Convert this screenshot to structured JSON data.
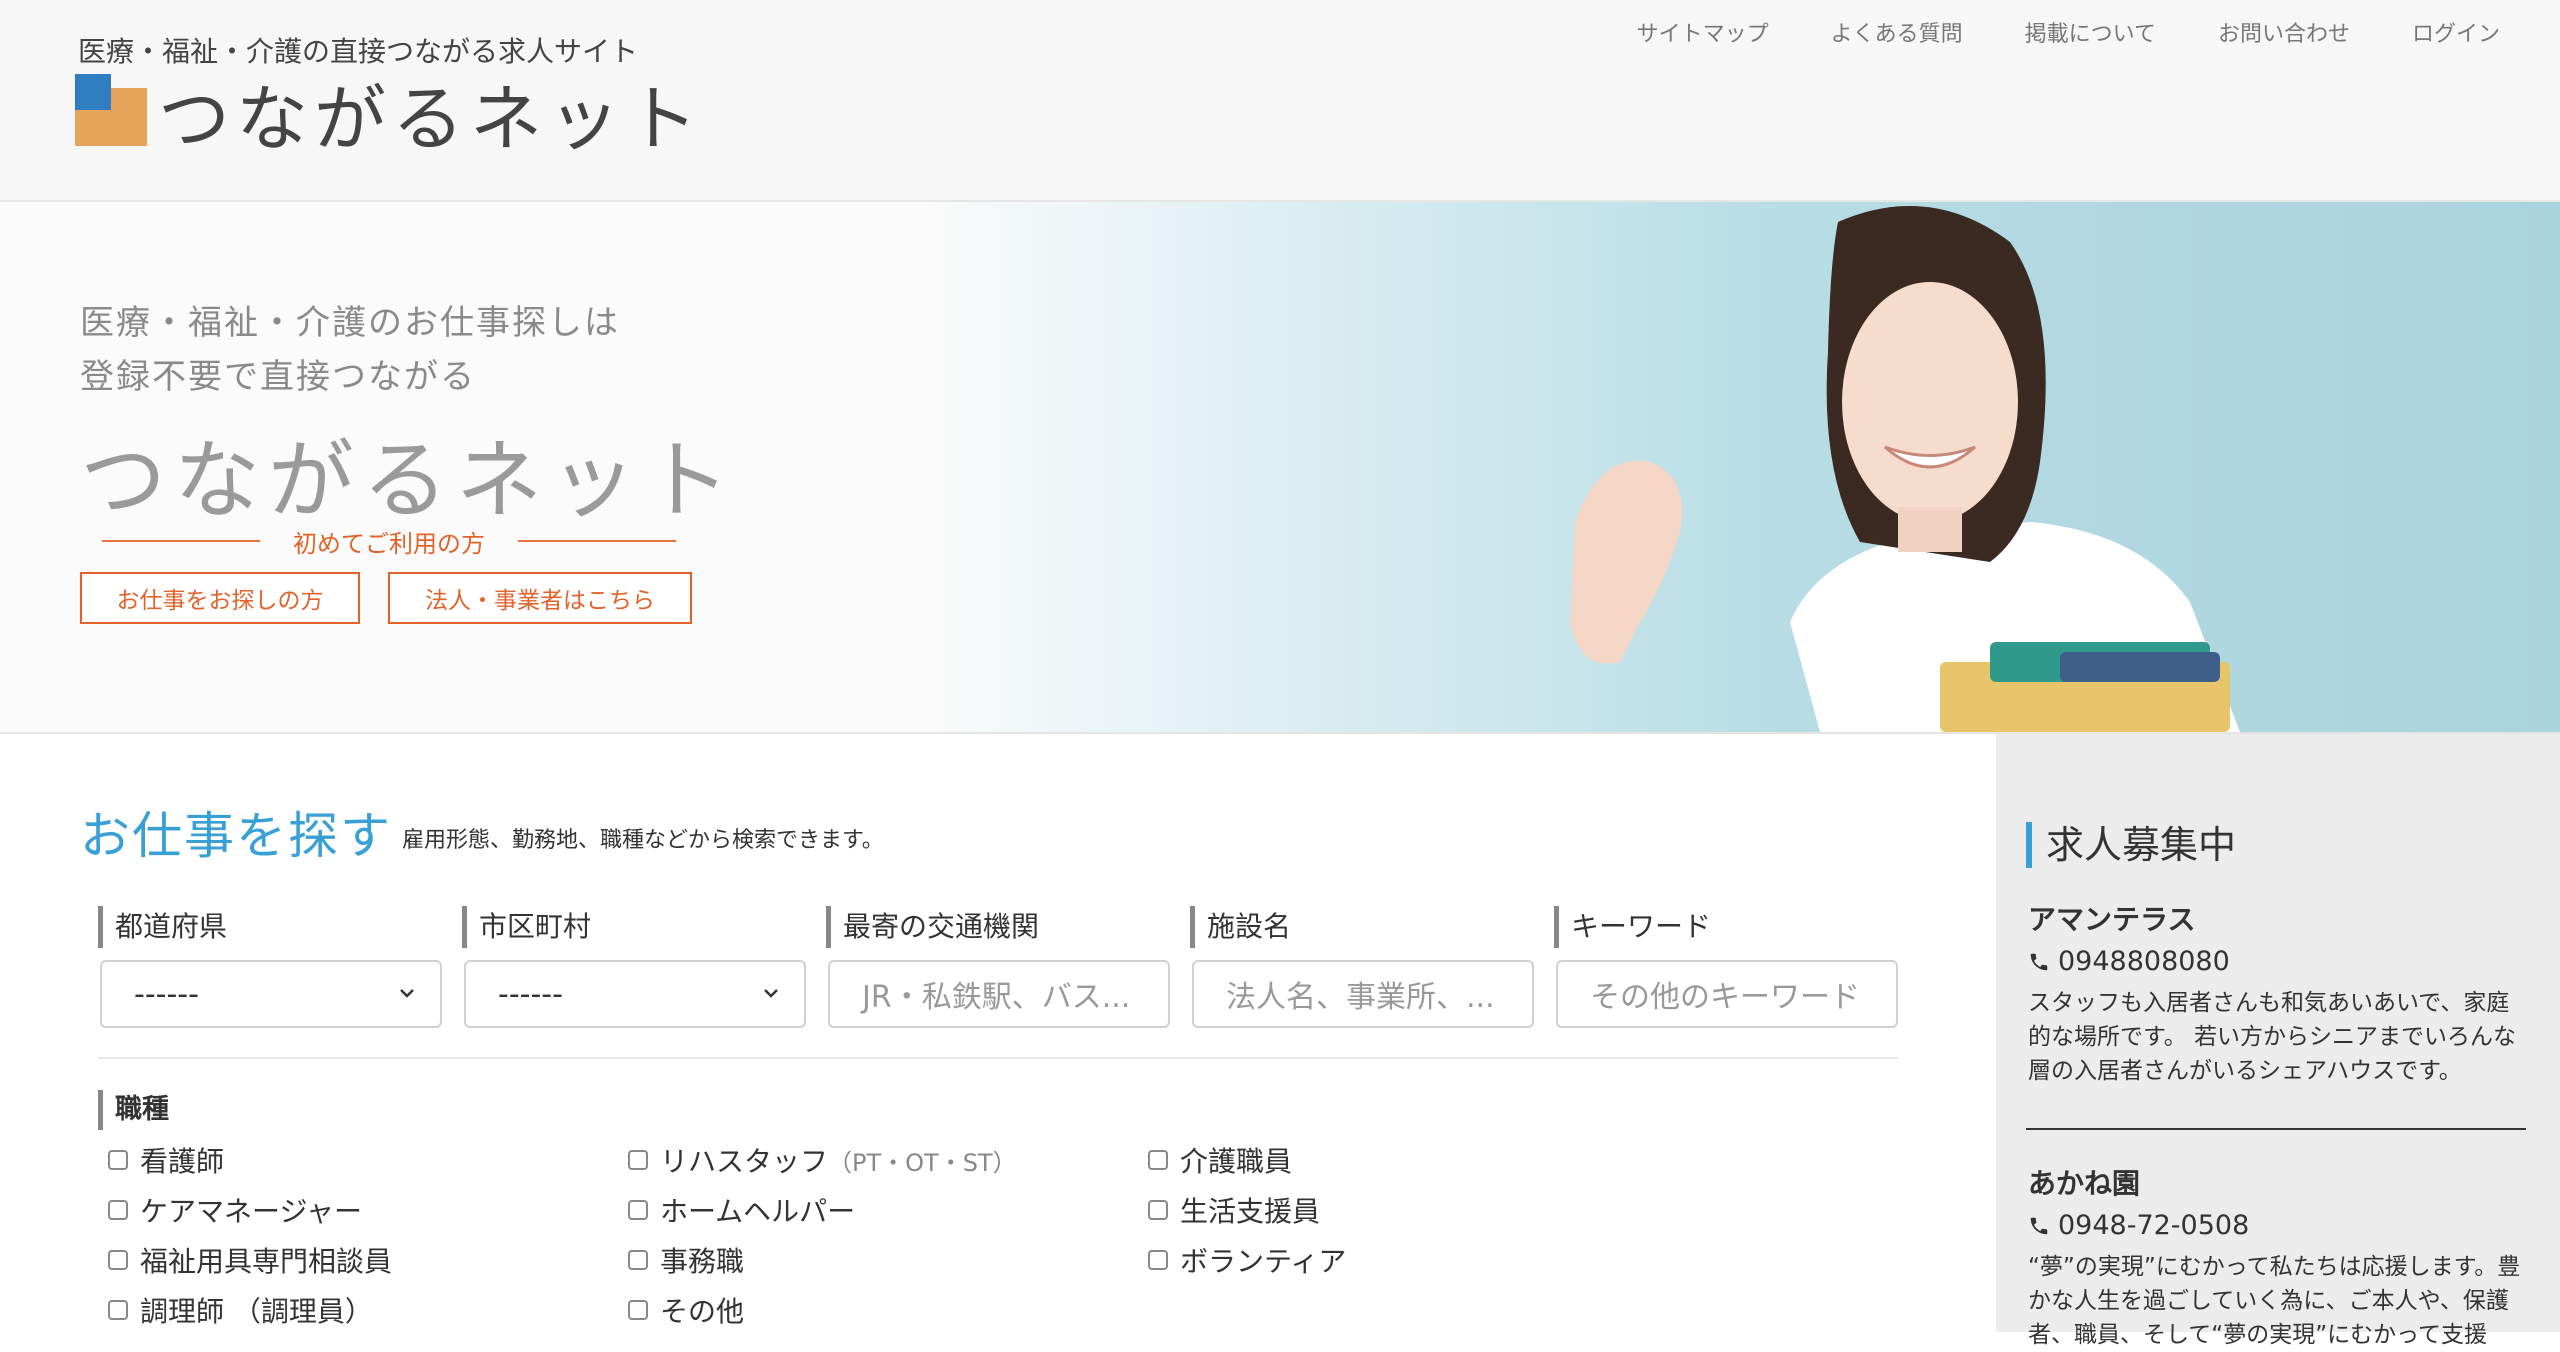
{
  "header": {
    "tagline": "医療・福祉・介護の直接つながる求人サイト",
    "logo_text": "つながるネット",
    "nav": [
      "サイトマップ",
      "よくある質問",
      "掲載について",
      "お問い合わせ",
      "ログイン"
    ]
  },
  "hero": {
    "sub_line1": "医療・福祉・介護のお仕事探しは",
    "sub_line2": "登録不要で直接つながる",
    "title": "つながるネット",
    "first_time": "初めてご利用の方",
    "btn_job": "お仕事をお探しの方",
    "btn_corp": "法人・事業者はこちら"
  },
  "search": {
    "title": "お仕事を探す",
    "desc": "雇用形態、勤務地、職種などから検索できます。",
    "fields": {
      "prefecture": {
        "label": "都道府県",
        "value": "------"
      },
      "city": {
        "label": "市区町村",
        "value": "------"
      },
      "transport": {
        "label": "最寄の交通機関",
        "placeholder": "JR・私鉄駅、バス..."
      },
      "facility": {
        "label": "施設名",
        "placeholder": "法人名、事業所、..."
      },
      "keyword": {
        "label": "キーワード",
        "placeholder": "その他のキーワード"
      }
    },
    "job_label": "職種",
    "jobs": {
      "col1": [
        "看護師",
        "ケアマネージャー",
        "福祉用具専門相談員",
        "調理師 （調理員）"
      ],
      "col2_first": "リハスタッフ",
      "col2_first_note": "（PT・OT・ST）",
      "col2": [
        "ホームヘルパー",
        "事務職",
        "その他"
      ],
      "col3": [
        "介護職員",
        "生活支援員",
        "ボランティア"
      ]
    }
  },
  "sidebar": {
    "title": "求人募集中",
    "items": [
      {
        "name": "アマンテラス",
        "phone": "0948808080",
        "desc": "スタッフも入居者さんも和気あいあいで、家庭的な場所です。 若い方からシニアまでいろんな層の入居者さんがいるシェアハウスです。"
      },
      {
        "name": "あかね園",
        "phone": "0948-72-0508",
        "desc": "“夢”の実現”にむかって私たちは応援します。豊かな人生を過ごしていく為に、ご本人や、保護者、職員、そして“夢の実現”にむかって支援"
      }
    ]
  },
  "colors": {
    "accent_blue": "#39a0d6",
    "accent_orange": "#e2632a",
    "sidebar_bg": "#ececec"
  }
}
